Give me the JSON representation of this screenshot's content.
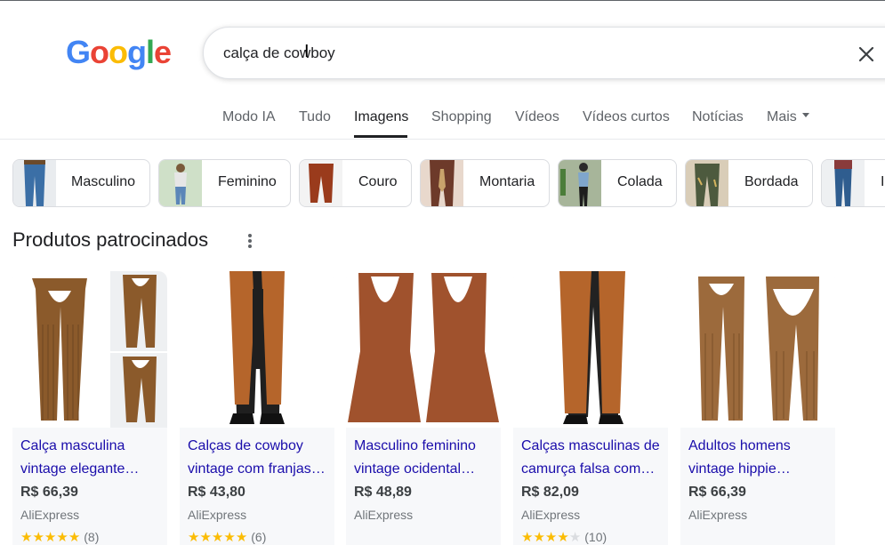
{
  "logo": {
    "letters": [
      "G",
      "o",
      "o",
      "g",
      "l",
      "e"
    ],
    "colors": [
      "#4285F4",
      "#EA4335",
      "#FBBC05",
      "#4285F4",
      "#34A853",
      "#EA4335"
    ]
  },
  "search": {
    "query": "calça de cowboy",
    "clear_icon": "close-icon"
  },
  "tabs": [
    {
      "label": "Modo IA"
    },
    {
      "label": "Tudo"
    },
    {
      "label": "Imagens",
      "active": true
    },
    {
      "label": "Shopping"
    },
    {
      "label": "Vídeos"
    },
    {
      "label": "Vídeos curtos"
    },
    {
      "label": "Notícias"
    },
    {
      "label": "Mais"
    }
  ],
  "chips": [
    {
      "label": "Masculino"
    },
    {
      "label": "Feminino"
    },
    {
      "label": "Couro"
    },
    {
      "label": "Montaria"
    },
    {
      "label": "Colada"
    },
    {
      "label": "Bordada"
    },
    {
      "label": "I"
    }
  ],
  "section": {
    "title": "Produtos patrocinados",
    "menu_icon": "more-vert-icon"
  },
  "products": [
    {
      "title_line1": "Calça masculina",
      "title_line2": "vintage elegante…",
      "price": "R$ 66,39",
      "store": "AliExpress",
      "rating": 5,
      "reviews": "(8)"
    },
    {
      "title_line1": "Calças de cowboy",
      "title_line2": "vintage com franjas…",
      "price": "R$ 43,80",
      "store": "AliExpress",
      "rating": 4.5,
      "reviews": "(6)"
    },
    {
      "title_line1": "Masculino feminino",
      "title_line2": "vintage ocidental…",
      "price": "R$ 48,89",
      "store": "AliExpress",
      "rating": null,
      "reviews": ""
    },
    {
      "title_line1": "Calças masculinas de",
      "title_line2": "camurça falsa com…",
      "price": "R$ 82,09",
      "store": "AliExpress",
      "rating": 3.5,
      "reviews": "(10)"
    },
    {
      "title_line1": "Adultos homens",
      "title_line2": "vintage hippie…",
      "price": "R$ 66,39",
      "store": "AliExpress",
      "rating": null,
      "reviews": ""
    }
  ],
  "colors": {
    "link": "#1a0dab",
    "star": "#fbbc04",
    "chaps": "#8b5a2b"
  }
}
